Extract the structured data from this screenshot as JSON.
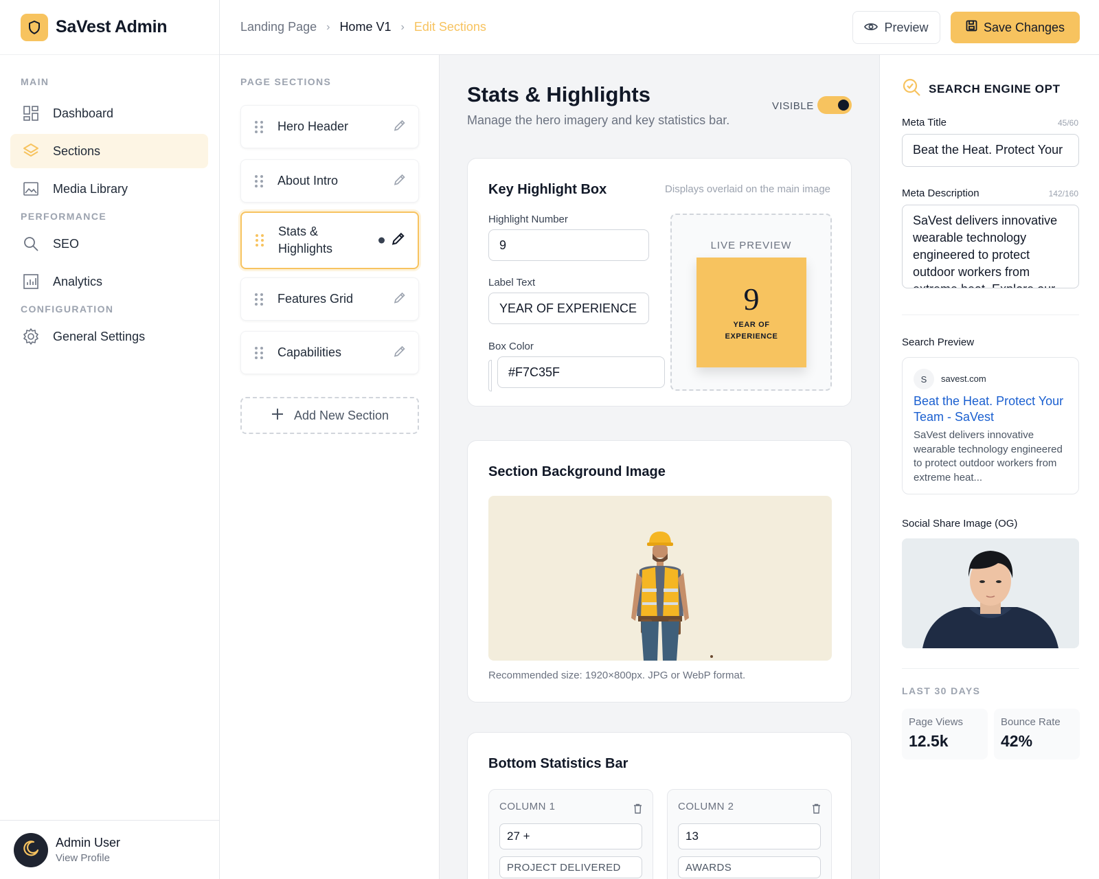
{
  "app": {
    "name": "SaVest Admin"
  },
  "sidebar": {
    "groups": [
      {
        "label": "MAIN",
        "items": [
          {
            "label": "Dashboard",
            "icon": "dashboard-icon"
          },
          {
            "label": "Sections",
            "icon": "layers-icon",
            "active": true
          },
          {
            "label": "Media Library",
            "icon": "image-icon"
          }
        ]
      },
      {
        "label": "PERFORMANCE",
        "items": [
          {
            "label": "SEO",
            "icon": "search-icon"
          },
          {
            "label": "Analytics",
            "icon": "chart-icon"
          }
        ]
      },
      {
        "label": "CONFIGURATION",
        "items": [
          {
            "label": "General Settings",
            "icon": "gear-icon"
          }
        ]
      }
    ],
    "profile": {
      "name": "Admin User",
      "link": "View Profile",
      "icon": "moon-icon"
    }
  },
  "breadcrumb": [
    "Landing Page",
    "Home V1",
    "Edit Sections"
  ],
  "toolbar": {
    "preview_label": "Preview",
    "save_label": "Save Changes"
  },
  "sections": {
    "label": "PAGE SECTIONS",
    "items": [
      {
        "title": "Hero Header"
      },
      {
        "title": "About Intro"
      },
      {
        "title": "Stats & Highlights",
        "active": true
      },
      {
        "title": "Features Grid"
      },
      {
        "title": "Capabilities"
      }
    ],
    "add_label": "Add New Section"
  },
  "editor": {
    "title": "Stats & Highlights",
    "subtitle": "Manage the hero imagery and key statistics bar.",
    "visible_label": "VISIBLE",
    "visible": true,
    "highlight": {
      "title": "Key Highlight Box",
      "hint": "Displays overlaid on the main image",
      "number_label": "Highlight Number",
      "number_value": "9",
      "text_label": "Label Text",
      "text_value": "YEAR OF EXPERIENCE",
      "color_label": "Box Color",
      "color_value": "#F7C35F",
      "preview_label": "LIVE PREVIEW",
      "preview_number": "9",
      "preview_text": "YEAR OF EXPERIENCE"
    },
    "background": {
      "title": "Section Background Image",
      "hint": "Recommended size: 1920×800px. JPG or WebP format."
    },
    "stats_bar": {
      "title": "Bottom Statistics Bar",
      "columns": [
        {
          "title": "COLUMN 1",
          "value": "27 +",
          "label": "PROJECT DELIVERED"
        },
        {
          "title": "COLUMN 2",
          "value": "13",
          "label": "AWARDS"
        }
      ]
    }
  },
  "seo": {
    "heading": "SEARCH ENGINE OPT",
    "meta_title_label": "Meta Title",
    "meta_title_count": "45/60",
    "meta_title_value": "Beat the Heat. Protect Your",
    "meta_desc_label": "Meta Description",
    "meta_desc_count": "142/160",
    "meta_desc_value": "SaVest delivers innovative wearable technology engineered to protect outdoor workers from extreme heat. Explore our",
    "search_preview_label": "Search Preview",
    "search_preview": {
      "favicon": "S",
      "domain": "savest.com",
      "title": "Beat the Heat. Protect Your Team - SaVest",
      "description": "SaVest delivers innovative wearable technology engineered to protect outdoor workers from extreme heat..."
    },
    "og_label": "Social Share Image (OG)",
    "stats_label": "LAST 30 DAYS",
    "stats": [
      {
        "label": "Page Views",
        "value": "12.5k"
      },
      {
        "label": "Bounce Rate",
        "value": "42%"
      }
    ]
  },
  "colors": {
    "accent": "#F7C35F",
    "link": "#1a5fd0",
    "text": "#111827"
  }
}
